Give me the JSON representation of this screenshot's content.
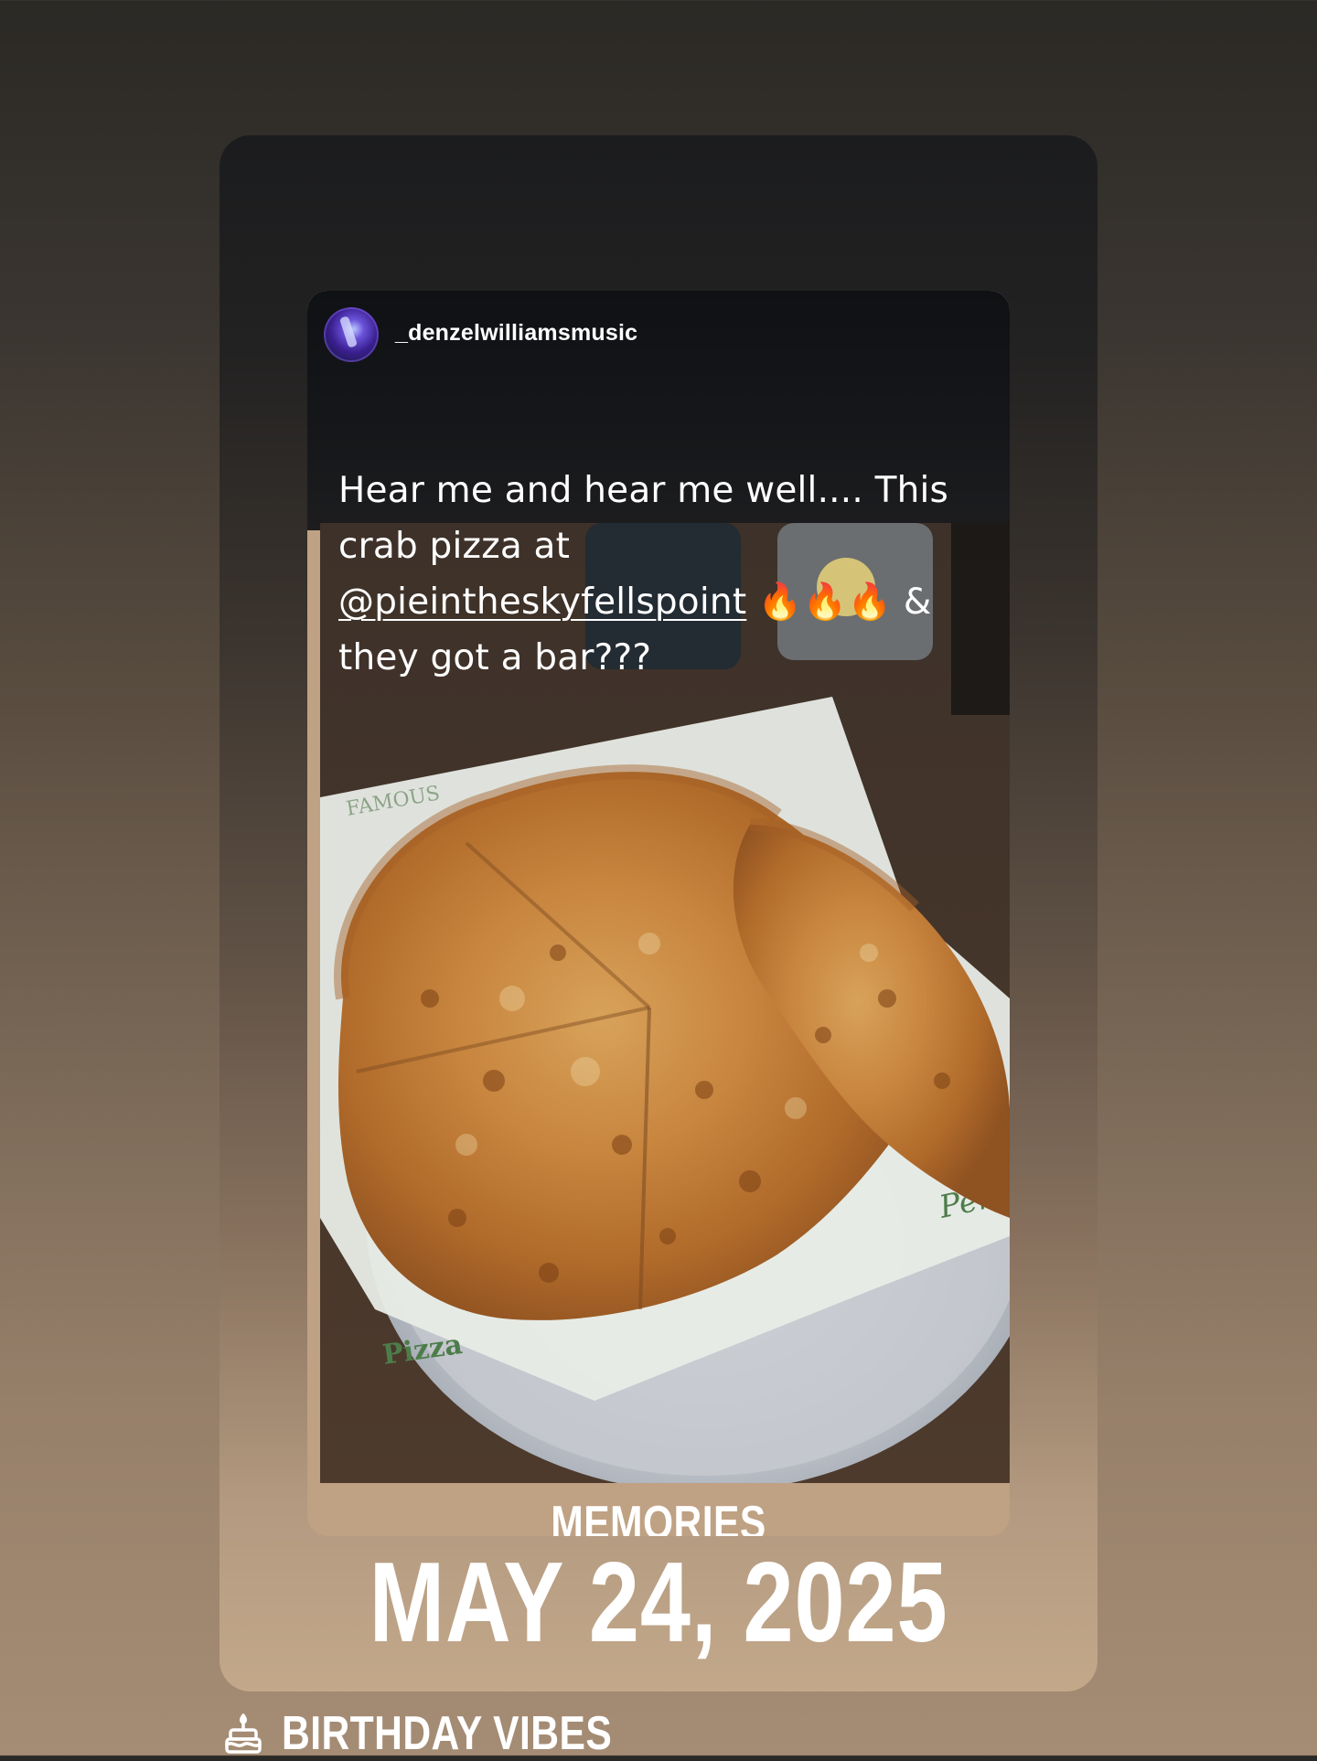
{
  "story": {
    "shared_post": {
      "username": "_denzelwilliamsmusic",
      "caption_line1": "Hear me and hear me well.... This",
      "caption_line2": "crab pizza at",
      "caption_mention": "@pieintheskyfellspoint",
      "caption_emojis": "🔥🔥🔥",
      "caption_tail": "&",
      "caption_line4": "they got a bar???"
    },
    "memories_label": "MEMORIES",
    "memory_date": "MAY 24, 2025",
    "bottom_label": "BIRTHDAY VIBES"
  },
  "icons": {
    "bottom_icon": "cake-icon",
    "avatar": "avatar-image"
  },
  "colors": {
    "background_top": "#2b2925",
    "background_bottom": "#a58c74",
    "card_bottom": "#c3a88a",
    "text": "#ffffff"
  }
}
